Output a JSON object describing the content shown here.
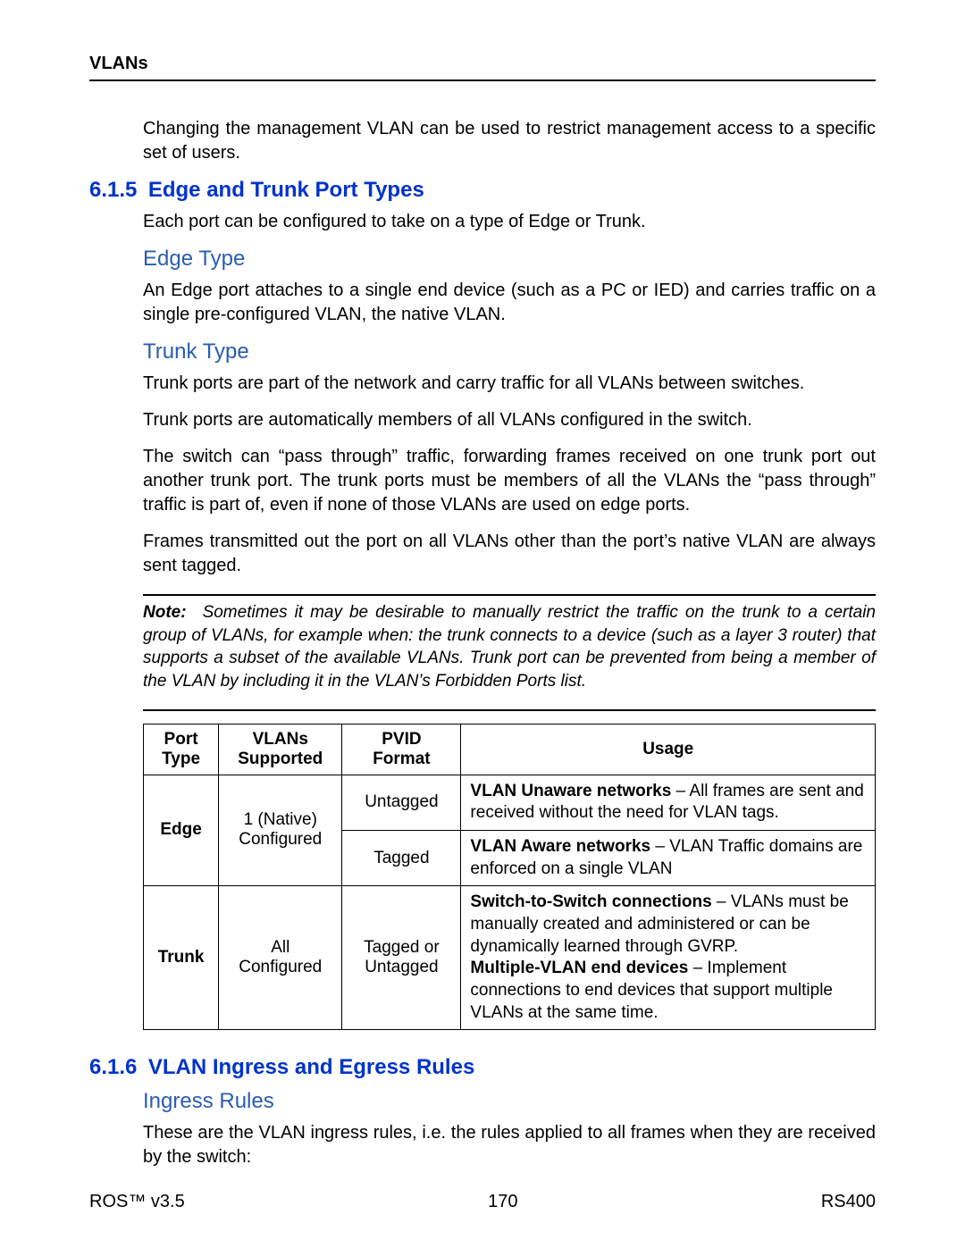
{
  "header": {
    "title": "VLANs"
  },
  "intro": {
    "p1": "Changing the management VLAN can be used to restrict management access to a specific set of users."
  },
  "section615": {
    "num": "6.1.5",
    "title": "Edge and Trunk Port Types",
    "intro": "Each port can be configured to take on a type of Edge or Trunk.",
    "edge": {
      "title": "Edge Type",
      "p1": "An Edge port attaches to a single end device (such as a PC or IED) and carries traffic on a single pre-configured VLAN, the native VLAN."
    },
    "trunk": {
      "title": "Trunk Type",
      "p1": "Trunk ports are part of the network and carry traffic for all VLANs between switches.",
      "p2": "Trunk ports are automatically members of all VLANs configured in the switch.",
      "p3": "The switch can “pass through” traffic, forwarding frames received on one trunk port out another trunk port. The trunk ports must be members of all the VLANs the “pass through” traffic is part of, even if none of those VLANs are used on edge ports.",
      "p4": "Frames transmitted out the port on all VLANs other than the port’s native VLAN are always sent tagged."
    },
    "note": {
      "label": "Note:",
      "text": "Sometimes it may be desirable to manually restrict the traffic on the trunk to a certain group of VLANs, for example when: the trunk connects to a device (such as a layer 3 router) that supports a subset of the available VLANs. Trunk port can be prevented from being a member of the VLAN by including it in the VLAN’s Forbidden Ports list."
    },
    "table": {
      "headers": {
        "c1": "Port Type",
        "c2": "VLANs Supported",
        "c3": "PVID Format",
        "c4": "Usage"
      },
      "edge": {
        "port": "Edge",
        "vlans_l1": "1 (Native)",
        "vlans_l2": "Configured",
        "r1": {
          "pvid": "Untagged",
          "usage_b": "VLAN Unaware networks",
          "usage_t": " – All frames are sent and received without the need for VLAN tags."
        },
        "r2": {
          "pvid": "Tagged",
          "usage_b": "VLAN Aware networks",
          "usage_t": " – VLAN Traffic domains are enforced on a single VLAN"
        }
      },
      "trunk": {
        "port": "Trunk",
        "vlans_l1": "All",
        "vlans_l2": "Configured",
        "pvid": "Tagged or Untagged",
        "usage_b1": "Switch-to-Switch connections",
        "usage_t1": " – VLANs must be manually created and administered or can be dynamically learned through GVRP.",
        "usage_b2": "Multiple-VLAN end devices",
        "usage_t2": " – Implement connections to end devices that support multiple VLANs at the same time."
      }
    }
  },
  "section616": {
    "num": "6.1.6",
    "title": "VLAN Ingress and Egress Rules",
    "ingress": {
      "title": "Ingress Rules",
      "p1": "These are the VLAN ingress rules, i.e. the rules applied to all frames when they are received by the switch:"
    }
  },
  "footer": {
    "left": "ROS™  v3.5",
    "center": "170",
    "right": "RS400"
  }
}
